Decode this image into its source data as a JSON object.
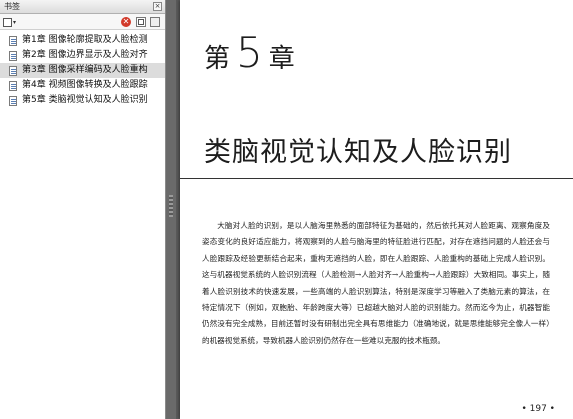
{
  "bookmarks_panel": {
    "title": "书签",
    "close_glyph": "×",
    "toolbar": {
      "options_icon": "options-menu-icon",
      "delete_icon": "delete-bookmark-icon",
      "delete_glyph": "✕",
      "expand_icon": "expand-bookmark-icon",
      "tag_icon": "tag-bookmark-icon"
    },
    "items": [
      {
        "label": "第1章 图像轮廓提取及人脸检测"
      },
      {
        "label": "第2章 图像边界显示及人脸对齐"
      },
      {
        "label": "第3章 图像采样编码及人脸重构"
      },
      {
        "label": "第4章 视频图像转换及人脸跟踪"
      },
      {
        "label": "第5章 类脑视觉认知及人脸识别"
      }
    ],
    "selected_index": 2
  },
  "document": {
    "chapter_prefix": "第",
    "chapter_number": "5",
    "chapter_suffix": "章",
    "chapter_title": "类脑视觉认知及人脸识别",
    "body": "大脑对人脸的识别，是以人脑海里熟悉的面部特征为基础的，然后依托其对人脸距离、观察角度及姿态变化的良好适应能力，将观察到的人脸与脑海里的特征脸进行匹配，对存在遮挡问题的人脸还会与人脸跟踪及经验更新结合起来，重构无遮挡的人脸，即在人脸跟踪、人脸重构的基础上完成人脸识别。这与机器视觉系统的人脸识别流程（人脸检测→人脸对齐→人脸重构→人脸跟踪）大致相同。事实上，随着人脸识别技术的快速发展，一些高端的人脸识别算法，特别是深度学习等融入了类脑元素的算法，在特定情况下（例如，双胞胎、年龄跨度大等）已超越大脑对人脸的识别能力。然而迄今为止，机器智能仍然没有完全成熟，目前还暂时没有研制出完全具有思维能力（准确地说，就是思维能够完全像人一样）的机器视觉系统，导致机器人脸识别仍然存在一些难以克服的技术瓶颈。",
    "page_number": "• 197 •"
  }
}
